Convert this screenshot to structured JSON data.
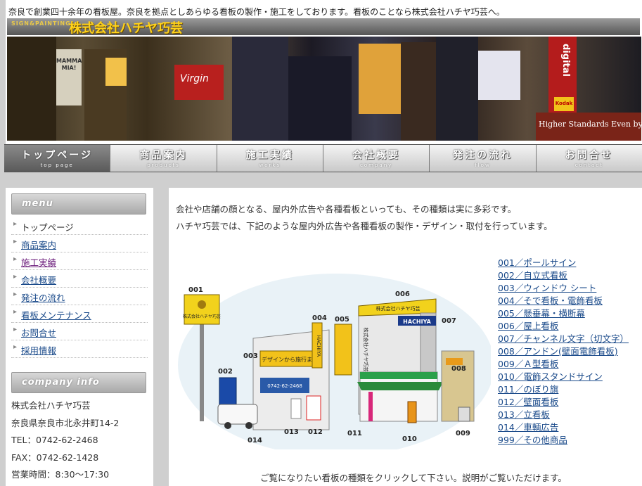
{
  "header": {
    "tagline": "奈良で創業四十余年の看板屋。奈良を拠点としあらゆる看板の製作・施工をしております。看板のことなら株式会社ハチヤ巧芸へ。",
    "logo_en": "SIGN&PAINTING",
    "logo_ja": "株式会社ハチヤ巧芸",
    "hero_signs": [
      "MAMMA MIA!",
      "Virgin",
      "digital",
      "Kodak",
      "Higher Standards Even by"
    ]
  },
  "nav": [
    {
      "ja": "トップページ",
      "en": "top page"
    },
    {
      "ja": "商品案内",
      "en": "products"
    },
    {
      "ja": "施工実績",
      "en": "works"
    },
    {
      "ja": "会社概要",
      "en": "company"
    },
    {
      "ja": "発注の流れ",
      "en": "flow"
    },
    {
      "ja": "お問合せ",
      "en": "contact"
    }
  ],
  "sidebar": {
    "menu_title": "menu",
    "menu": [
      "トップページ",
      "商品案内",
      "施工実績",
      "会社概要",
      "発注の流れ",
      "看板メンテナンス",
      "お問合せ",
      "採用情報"
    ],
    "company_title": "company info",
    "company": [
      "株式会社ハチヤ巧芸",
      "奈良県奈良市北永井町14-2",
      "TEL：0742-62-2468",
      "FAX：0742-62-1428",
      "営業時間：8:30～17:30"
    ]
  },
  "main": {
    "intro1": "会社や店舗の顔となる、屋内外広告や各種看板といっても、その種類は実に多彩です。",
    "intro2": "ハチヤ巧芸では、下記のような屋内外広告や各種看板の製作・デザイン・取付を行っています。",
    "illustration": {
      "numbers": [
        "001",
        "002",
        "003",
        "004",
        "005",
        "006",
        "007",
        "008",
        "009",
        "010",
        "011",
        "012",
        "013",
        "014"
      ],
      "texts": {
        "pole_brand": "株式会社ハチヤ巧芸",
        "rooftop": "株式会社ハチヤ巧芸",
        "hachiya": "HACHIYA",
        "wall_copy": "デザインから施行まで",
        "tel": "0742-62-2468",
        "vertical": "HACHIYA",
        "vertical2": "株式会社ハチヤ巧芸"
      }
    },
    "sign_types": [
      "001／ポールサイン",
      "002／自立式看板",
      "003／ウィンドウ シート",
      "004／そで看板・電飾看板",
      "005／懸垂幕・横断幕",
      "006／屋上看板",
      "007／チャンネル文字（切文字）",
      "008／アンドン(壁面電飾看板)",
      "009／Ａ型看板",
      "010／電飾スタンドサイン",
      "011／のぼり旗",
      "012／壁面看板",
      "013／立看板",
      "014／車輌広告",
      "999／その他商品"
    ],
    "footer_note": "ご覧になりたい看板の種類をクリックして下さい。説明がご覧いただけます。"
  }
}
